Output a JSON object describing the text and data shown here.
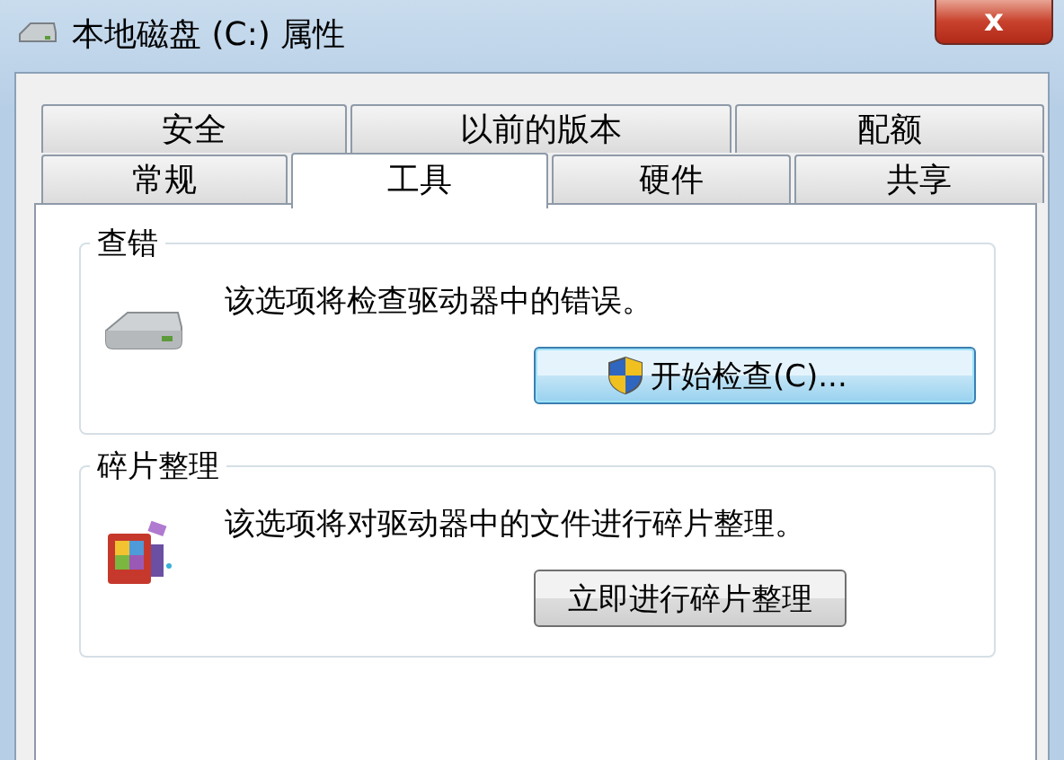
{
  "window": {
    "title": "本地磁盘 (C:) 属性",
    "close": "x"
  },
  "tab_rows": [
    [
      {
        "label": "安全",
        "selected": false
      },
      {
        "label": "以前的版本",
        "selected": false
      },
      {
        "label": "配额",
        "selected": false
      }
    ],
    [
      {
        "label": "常规",
        "selected": false
      },
      {
        "label": "工具",
        "selected": true
      },
      {
        "label": "硬件",
        "selected": false
      },
      {
        "label": "共享",
        "selected": false
      }
    ]
  ],
  "groups": [
    {
      "kind": "check",
      "title": "查错",
      "description": "该选项将检查驱动器中的错误。",
      "button": {
        "label": "开始检查(C)...",
        "focused": true,
        "shield": true
      }
    },
    {
      "kind": "defrag",
      "title": "碎片整理",
      "description": "该选项将对驱动器中的文件进行碎片整理。",
      "button": {
        "label": "立即进行碎片整理",
        "focused": false,
        "shield": false
      }
    }
  ]
}
